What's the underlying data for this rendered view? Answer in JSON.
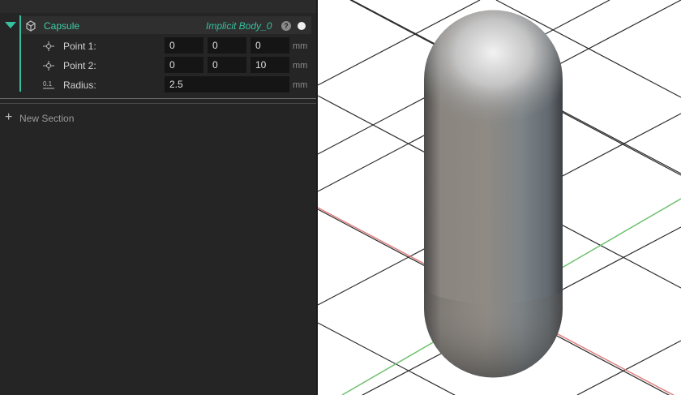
{
  "section": {
    "title": "Capsule",
    "body_name": "Implicit Body_0",
    "help_glyph": "?",
    "icon": "capsule-cube-icon",
    "expanded": true,
    "rows": [
      {
        "label": "Point 1:",
        "icon": "point-crosshair-icon",
        "values": [
          "0",
          "0",
          "0"
        ],
        "unit": "mm"
      },
      {
        "label": "Point 2:",
        "icon": "point-crosshair-icon",
        "values": [
          "0",
          "0",
          "10"
        ],
        "unit": "mm"
      },
      {
        "label": "Radius:",
        "icon": "radius-0.1-icon",
        "values": [
          "2.5"
        ],
        "unit": "mm"
      }
    ],
    "radius_icon_text": "0.1"
  },
  "new_section": {
    "label": "New Section",
    "icon": "plus-icon"
  },
  "colors": {
    "accent": "#36c0a0",
    "panel_bg": "#252525",
    "field_bg": "#151515",
    "viewport_bg": "#ffffff",
    "grid": "#2a2a2a",
    "axis_x": "#e08080",
    "axis_y": "#70c070"
  }
}
